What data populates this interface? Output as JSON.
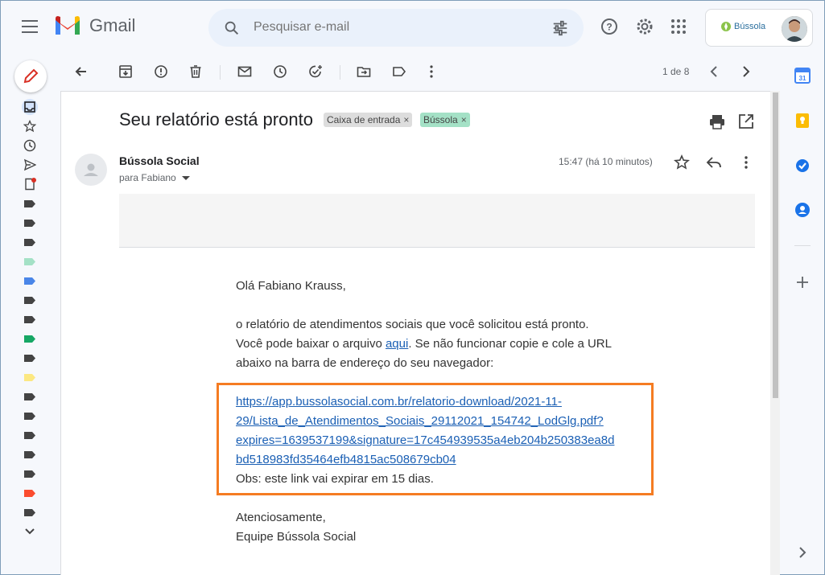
{
  "app": {
    "name": "Gmail"
  },
  "search": {
    "placeholder": "Pesquisar e-mail"
  },
  "account": {
    "brand": "Bússola"
  },
  "toolbar": {
    "pager": "1 de 8"
  },
  "email": {
    "subject": "Seu relatório está pronto",
    "labels": [
      {
        "text": "Caixa de entrada",
        "color": "#dddddd"
      },
      {
        "text": "Bússola",
        "color": "#a4e1c6"
      }
    ],
    "sender": "Bússola Social",
    "to": "para Fabiano",
    "time": "15:47 (há 10 minutos)",
    "greeting": "Olá Fabiano Krauss,",
    "p1": "o relatório de atendimentos sociais que você solicitou está pronto.",
    "p2_a": "Você pode baixar o arquivo ",
    "p2_link": "aqui",
    "p2_b": ". Se não funcionar copie e cole a URL",
    "p2_c": "abaixo na barra de endereço do seu navegador:",
    "url_lines": [
      "https://app.bussolasocial.com.br/relatorio-download/2021-11-",
      "29/Lista_de_Atendimentos_Sociais_29112021_154742_LodGlg.pdf?",
      "expires=1639537199&signature=17c454939535a4eb204b250383ea8d",
      "bd518983fd35464efb4815ac508679cb04"
    ],
    "obs": "Obs: este link vai expirar em 15 dias.",
    "closing": "Atenciosamente,",
    "signature": "Equipe Bússola Social"
  },
  "colors": {
    "highlight": "#f57c22",
    "link": "#1a5fb4"
  }
}
